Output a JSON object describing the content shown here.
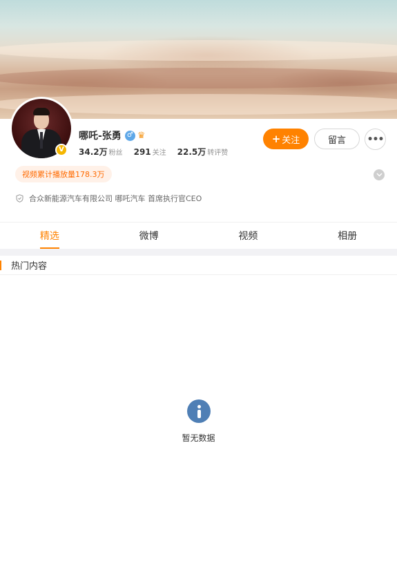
{
  "profile": {
    "name": "哪吒-张勇",
    "gender_icon": "male-icon",
    "level_icon": "crown-badge-icon",
    "verified_badge_icon": "verified-v-icon",
    "verified_badge_glyph": "V",
    "stats": [
      {
        "num": "34.2万",
        "label": "粉丝"
      },
      {
        "num": "291",
        "label": "关注"
      },
      {
        "num": "22.5万",
        "label": "转评赞"
      }
    ],
    "video_plays": "视频累计播放量178.3万",
    "company": "合众新能源汽车有限公司 哪吒汽车 首席执行官CEO"
  },
  "actions": {
    "follow_plus": "+",
    "follow_label": "关注",
    "message_label": "留言",
    "more_label": "•••"
  },
  "tabs": [
    {
      "label": "精选",
      "active": true
    },
    {
      "label": "微博",
      "active": false
    },
    {
      "label": "视频",
      "active": false
    },
    {
      "label": "相册",
      "active": false
    }
  ],
  "section": {
    "title": "热门内容"
  },
  "empty": {
    "text": "暂无数据",
    "icon": "info-icon"
  },
  "colors": {
    "accent": "#ff8200",
    "badge": "#f5b600",
    "info": "#4f7fb5",
    "gender": "#5fa8e8"
  }
}
